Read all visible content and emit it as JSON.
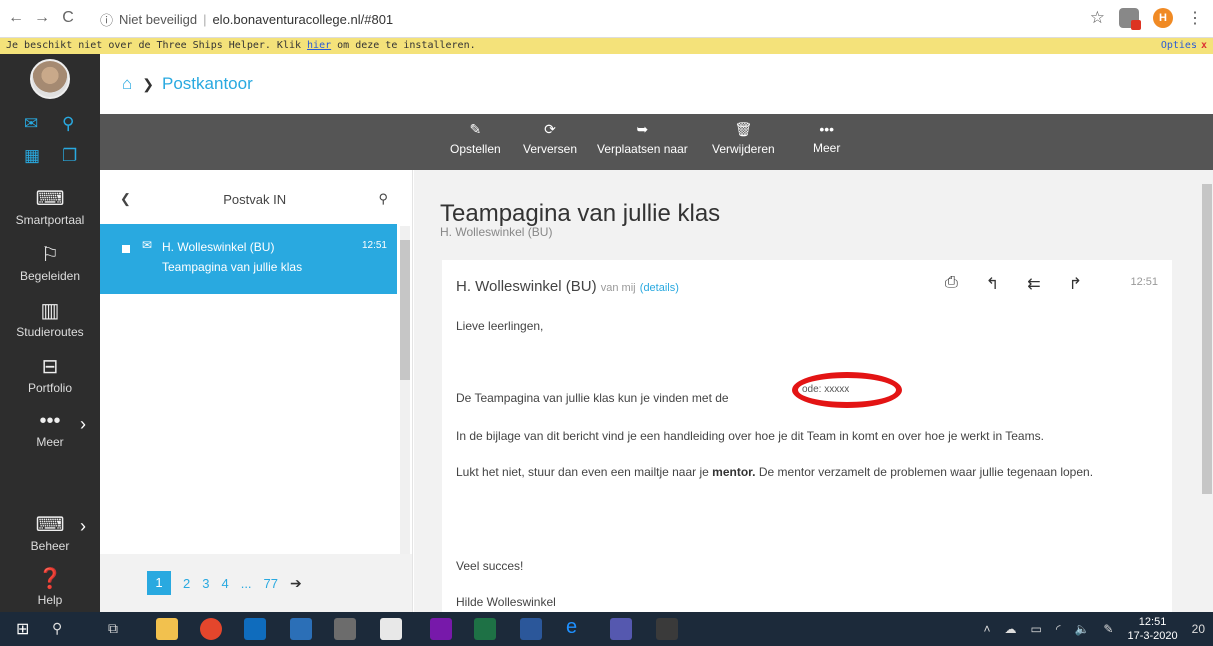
{
  "browser": {
    "back": "←",
    "forward": "→",
    "reload": "C",
    "security": "Niet beveiligd",
    "url": "elo.bonaventuracollege.nl/#801",
    "profile_initial": "H"
  },
  "helper": {
    "text_before": "Je beschikt niet over de Three Ships Helper. Klik ",
    "link": "hier",
    "text_after": " om deze te installeren.",
    "options": "Opties",
    "close": "x"
  },
  "sidebar": {
    "items": [
      {
        "label": "Smartportaal",
        "icon": "keyboard-icon"
      },
      {
        "label": "Begeleiden",
        "icon": "signpost-icon"
      },
      {
        "label": "Studieroutes",
        "icon": "books-icon"
      },
      {
        "label": "Portfolio",
        "icon": "briefcase-icon"
      },
      {
        "label": "Meer",
        "icon": "more-icon"
      },
      {
        "label": "Beheer",
        "icon": "keyboard-icon"
      },
      {
        "label": "Help",
        "icon": "help-icon"
      }
    ]
  },
  "breadcrumb": {
    "page": "Postkantoor"
  },
  "toolbar": {
    "compose": "Opstellen",
    "refresh": "Verversen",
    "move": "Verplaatsen naar",
    "delete": "Verwijderen",
    "more": "Meer"
  },
  "mailbox": {
    "title": "Postvak IN",
    "item": {
      "from": "H. Wolleswinkel (BU)",
      "time": "12:51",
      "subject": "Teampagina van jullie klas"
    },
    "pager": {
      "pages": [
        "1",
        "2",
        "3",
        "4",
        "...",
        "77"
      ]
    }
  },
  "message": {
    "title": "Teampagina van jullie klas",
    "subtitle": "H. Wolleswinkel (BU)",
    "from": "H. Wolleswinkel (BU)",
    "van_mij": "van mij",
    "details": "(details)",
    "time": "12:51",
    "greeting": "Lieve leerlingen,",
    "line1": "De Teampagina van jullie klas kun je vinden met de",
    "code": "ode: xxxxx",
    "line2": "In de bijlage van dit bericht vind je een handleiding over hoe je dit Team in komt en over hoe je werkt in Teams.",
    "line3_before": "Lukt het niet, stuur dan even een mailtje naar je ",
    "line3_bold": "mentor.",
    "line3_after": " De mentor verzamelt de problemen waar jullie tegenaan lopen.",
    "closing": "Veel succes!",
    "signature": "Hilde Wolleswinkel"
  },
  "taskbar": {
    "time": "12:51",
    "date": "17-3-2020",
    "notifications": "20"
  },
  "colors": {
    "accent": "#29a9e0",
    "sidebar": "#2d2d2d",
    "toolbar": "#555555",
    "highlight": "#e31414"
  }
}
